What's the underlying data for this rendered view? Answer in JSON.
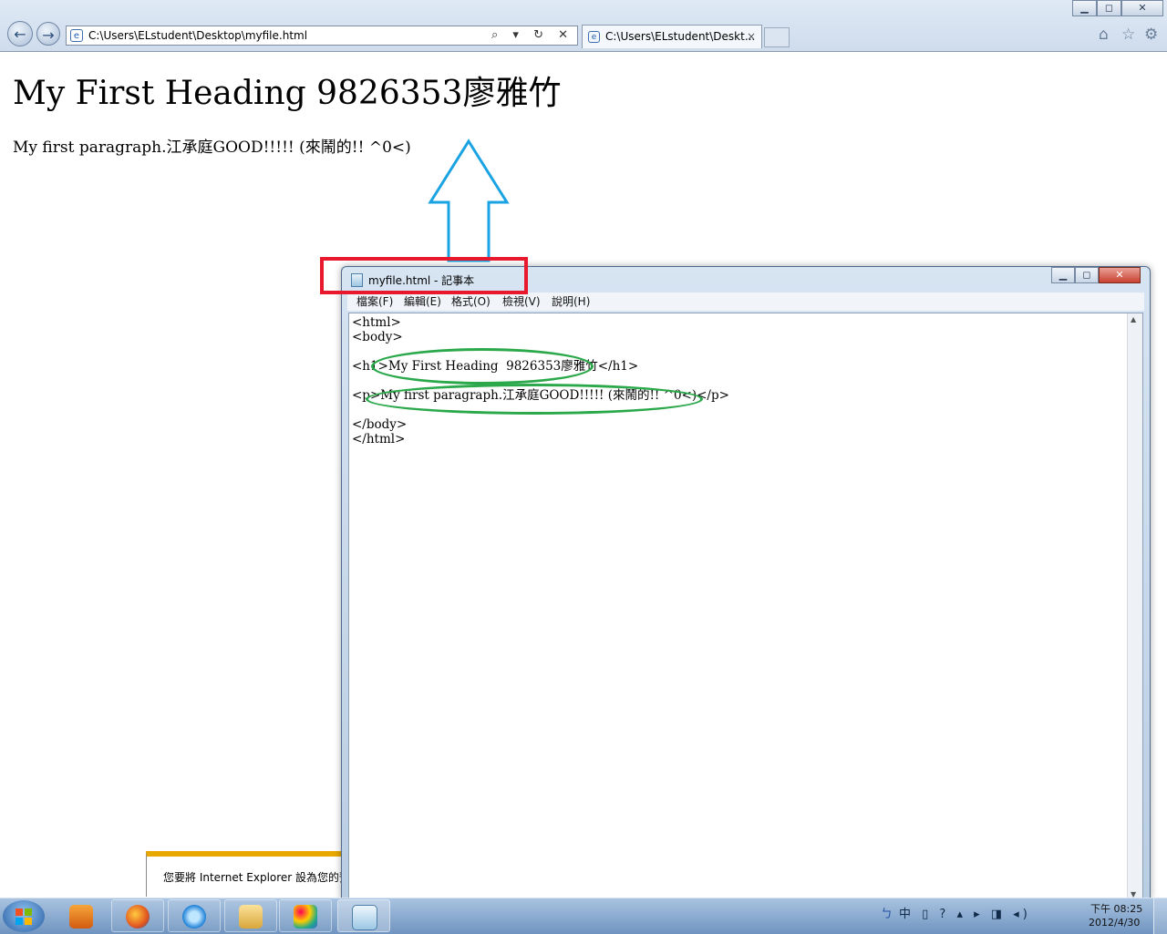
{
  "browser": {
    "address": "C:\\Users\\ELstudent\\Desktop\\myfile.html",
    "address_tools": "⌕ ▾ ↻ ✕",
    "tab_title": "C:\\Users\\ELstudent\\Deskt...",
    "tab_close": "×",
    "tab_icon": "e",
    "back_icon": "←",
    "forward_icon": "→",
    "home_icon": "⌂",
    "favorites_icon": "☆",
    "tools_icon": "⚙"
  },
  "page": {
    "heading": "My First Heading 9826353廖雅竹",
    "paragraph": "My first paragraph.江承庭GOOD!!!!! (來鬧的!! ^0<)",
    "notification": "您要將 Internet Explorer 設為您的預"
  },
  "notepad": {
    "title": "myfile.html - 記事本",
    "menu": [
      "檔案(F)",
      "編輯(E)",
      "格式(O)",
      "檢視(V)",
      "說明(H)"
    ],
    "content": "<html>\n<body>\n\n<h1>My First Heading  9826353廖雅竹</h1>\n\n<p>My first paragraph.江承庭GOOD!!!!! (來鬧的!! ^0<)</p>\n\n</body>\n</html>",
    "scroll_up": "▲",
    "scroll_down": "▼"
  },
  "window_controls": {
    "minimize": "▁",
    "maximize": "◻",
    "close": "✕"
  },
  "taskbar": {
    "tray_icons": "中 ▯ ? ▴ ▸ ◨ ◂)",
    "ime_icon": "ㄅ",
    "time": "下午 08:25",
    "date": "2012/4/30"
  },
  "annotations": {
    "arrow_color": "#1aa3e3",
    "box_color": "#e8192c",
    "ellipse_color": "#2aa84a"
  }
}
